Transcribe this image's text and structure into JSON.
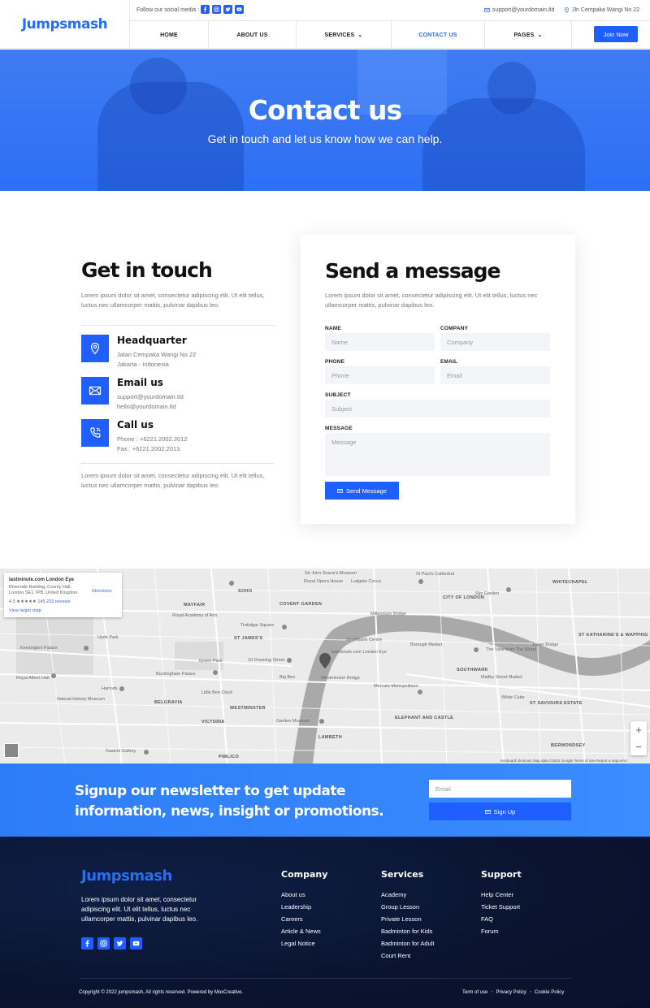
{
  "header": {
    "logo": "Jumpsmash",
    "follow_label": "Follow our social media :",
    "email": "support@yourdomain.tld",
    "address": "Jln Cempaka Wangi No 22",
    "nav": [
      "HOME",
      "ABOUT US",
      "SERVICES",
      "CONTACT US",
      "PAGES"
    ],
    "join_label": "Join Now"
  },
  "hero": {
    "title": "Contact us",
    "subtitle": "Get in touch and let us know how we can help."
  },
  "get_in_touch": {
    "title": "Get in touch",
    "desc": "Lorem ipsum dolor sit amet, consectetur adipiscing elit. Ut elit tellus, luctus nec ullamcorper mattis, pulvinar dapibus leo.",
    "items": [
      {
        "heading": "Headquarter",
        "line1": "Jalan Cempaka Wangi No 22",
        "line2": "Jakarta - Indonesia"
      },
      {
        "heading": "Email us",
        "line1": "support@yourdomain.tld",
        "line2": "hello@yourdomain.tld"
      },
      {
        "heading": "Call us",
        "line1": "Phone : +6221.2002.2012",
        "line2": "Fax : +6221.2002.2013"
      }
    ],
    "footer_text": "Lorem ipsum dolor sit amet, consectetur adipiscing elit. Ut elit tellus, luctus nec ullamcorper mattis, pulvinar dapibus leo."
  },
  "form": {
    "title": "Send a message",
    "desc": "Lorem ipsum dolor sit amet, consectetur adipiscing elit. Ut elit tellus, luctus nec ullamcorper mattis, pulvinar dapibus leo.",
    "fields": {
      "name": {
        "label": "NAME",
        "placeholder": "Name"
      },
      "company": {
        "label": "COMPANY",
        "placeholder": "Company"
      },
      "phone": {
        "label": "PHONE",
        "placeholder": "Phone"
      },
      "email": {
        "label": "EMAIL",
        "placeholder": "Email"
      },
      "subject": {
        "label": "SUBJECT",
        "placeholder": "Subject"
      },
      "message": {
        "label": "MESSAGE",
        "placeholder": "Message"
      }
    },
    "submit_label": "Send Message"
  },
  "map": {
    "place_title": "lastminute.com London Eye",
    "place_address": "Riverside Building, County Hall, London SE1 7PB, United Kingdom",
    "rating": "4.5 ★★★★★",
    "reviews": "145,233 reviews",
    "larger_map": "View larger map",
    "directions": "Directions",
    "pin_label": "lastminute.com London Eye",
    "labels": [
      "Sir John Soane's Museum",
      "St Paul's Cathedral",
      "WHITECHAPEL",
      "SOHO",
      "Royal Opera House",
      "Ludgate Circus",
      "MAYFAIR",
      "COVENT GARDEN",
      "CITY OF LONDON",
      "Sky Garden",
      "Royal Academy of Arts",
      "Trafalgar Square",
      "Millennium Bridge",
      "Hyde Park",
      "ST JAMES'S",
      "Southbank Centre",
      "Borough Market",
      "ST KATHARINE'S & WAPPING",
      "Kensington Palace",
      "Tower Bridge",
      "The View from The Shard",
      "Green Park",
      "10 Downing Street",
      "Buckingham Palace",
      "SOUTHWARK",
      "Royal Albert Hall",
      "Big Ben",
      "Westminster Bridge",
      "Maltby Street Market",
      "Harrods",
      "Little Ben Clock",
      "Mercato Metropolitano",
      "Natural History Museum",
      "BELGRAVIA",
      "WESTMINSTER",
      "White Cube",
      "ST SAVIOURS ESTATE",
      "VICTORIA",
      "Garden Museum",
      "ELEPHANT AND CASTLE",
      "BERMONDSEY",
      "LAMBETH",
      "PIMLICO",
      "Saatchi Gallery"
    ],
    "footer": "Keyboard shortcuts   Map data ©2022 Google   Terms of Use   Report a map error"
  },
  "newsletter": {
    "title": "Signup our newsletter to get update information, news, insight or promotions.",
    "email_placeholder": "Email",
    "button_label": "Sign Up"
  },
  "footer": {
    "logo": "Jumpsmash",
    "desc": "Lorem ipsum dolor sit amet, consectetur adipiscing elit. Ut elit tellus, luctus nec ullamcorper mattis, pulvinar dapibus leo.",
    "columns": [
      {
        "title": "Company",
        "items": [
          "About us",
          "Leadership",
          "Careers",
          "Article & News",
          "Legal Notice"
        ]
      },
      {
        "title": "Services",
        "items": [
          "Academy",
          "Group Lesson",
          "Private Lesson",
          "Badminton for Kids",
          "Badminton for Adult",
          "Court Rent"
        ]
      },
      {
        "title": "Support",
        "items": [
          "Help Center",
          "Ticket Support",
          "FAQ",
          "Forum"
        ]
      }
    ],
    "copyright": "Copyright © 2022 jumpsmash, All rights reserved. Powered by MoxCreative.",
    "links": [
      "Term of use",
      "Privacy Policy",
      "Cookie Policy"
    ]
  },
  "colors": {
    "accent": "#1f5eff",
    "footer_bg": "#0a1430"
  },
  "icons": [
    "facebook-icon",
    "instagram-icon",
    "twitter-icon",
    "youtube-icon",
    "mail-icon",
    "location-pin-icon",
    "phone-icon",
    "chevron-down-icon"
  ]
}
